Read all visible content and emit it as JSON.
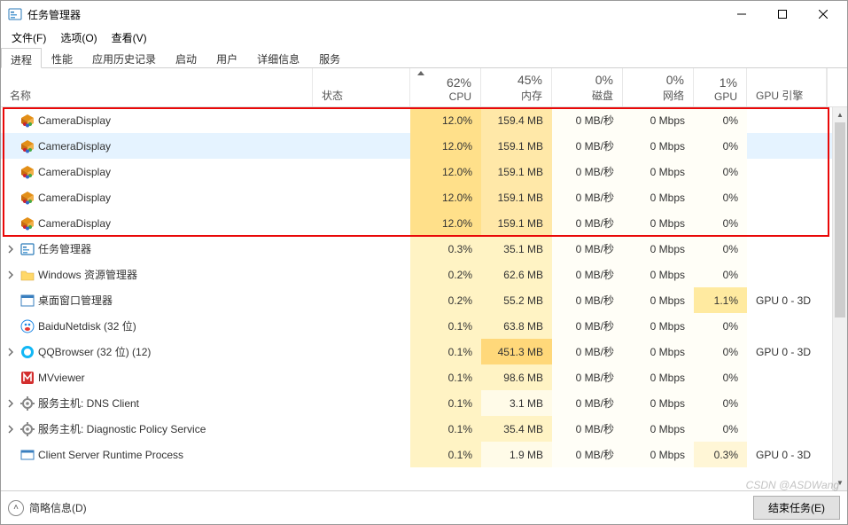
{
  "titlebar": {
    "title": "任务管理器"
  },
  "menubar": {
    "file": "文件(F)",
    "options": "选项(O)",
    "view": "查看(V)"
  },
  "tabs": [
    "进程",
    "性能",
    "应用历史记录",
    "启动",
    "用户",
    "详细信息",
    "服务"
  ],
  "active_tab": 0,
  "columns": {
    "name": "名称",
    "status": "状态",
    "cpu": {
      "pct": "62%",
      "label": "CPU"
    },
    "mem": {
      "pct": "45%",
      "label": "内存"
    },
    "disk": {
      "pct": "0%",
      "label": "磁盘"
    },
    "net": {
      "pct": "0%",
      "label": "网络"
    },
    "gpu": {
      "pct": "1%",
      "label": "GPU"
    },
    "gpuengine": "GPU 引擎"
  },
  "rows": [
    {
      "expand": false,
      "icon": "cube",
      "name": "CameraDisplay",
      "cpu": "12.0%",
      "mem": "159.4 MB",
      "disk": "0 MB/秒",
      "net": "0 Mbps",
      "gpu": "0%",
      "gpuengine": "",
      "cpu_cls": "heat-cpu-12",
      "mem_cls": "heat-mem-159",
      "selected": false
    },
    {
      "expand": false,
      "icon": "cube",
      "name": "CameraDisplay",
      "cpu": "12.0%",
      "mem": "159.1 MB",
      "disk": "0 MB/秒",
      "net": "0 Mbps",
      "gpu": "0%",
      "gpuengine": "",
      "cpu_cls": "heat-cpu-12",
      "mem_cls": "heat-mem-159",
      "selected": true
    },
    {
      "expand": false,
      "icon": "cube",
      "name": "CameraDisplay",
      "cpu": "12.0%",
      "mem": "159.1 MB",
      "disk": "0 MB/秒",
      "net": "0 Mbps",
      "gpu": "0%",
      "gpuengine": "",
      "cpu_cls": "heat-cpu-12",
      "mem_cls": "heat-mem-159",
      "selected": false
    },
    {
      "expand": false,
      "icon": "cube",
      "name": "CameraDisplay",
      "cpu": "12.0%",
      "mem": "159.1 MB",
      "disk": "0 MB/秒",
      "net": "0 Mbps",
      "gpu": "0%",
      "gpuengine": "",
      "cpu_cls": "heat-cpu-12",
      "mem_cls": "heat-mem-159",
      "selected": false
    },
    {
      "expand": false,
      "icon": "cube",
      "name": "CameraDisplay",
      "cpu": "12.0%",
      "mem": "159.1 MB",
      "disk": "0 MB/秒",
      "net": "0 Mbps",
      "gpu": "0%",
      "gpuengine": "",
      "cpu_cls": "heat-cpu-12",
      "mem_cls": "heat-mem-159",
      "selected": false
    },
    {
      "expand": true,
      "icon": "tm",
      "name": "任务管理器",
      "cpu": "0.3%",
      "mem": "35.1 MB",
      "disk": "0 MB/秒",
      "net": "0 Mbps",
      "gpu": "0%",
      "gpuengine": "",
      "cpu_cls": "heat-cpu-low",
      "mem_cls": "heat-mem-mid",
      "selected": false
    },
    {
      "expand": true,
      "icon": "folder",
      "name": "Windows 资源管理器",
      "cpu": "0.2%",
      "mem": "62.6 MB",
      "disk": "0 MB/秒",
      "net": "0 Mbps",
      "gpu": "0%",
      "gpuengine": "",
      "cpu_cls": "heat-cpu-low",
      "mem_cls": "heat-mem-mid",
      "selected": false
    },
    {
      "expand": false,
      "icon": "dwm",
      "name": "桌面窗口管理器",
      "cpu": "0.2%",
      "mem": "55.2 MB",
      "disk": "0 MB/秒",
      "net": "0 Mbps",
      "gpu": "1.1%",
      "gpuengine": "GPU 0 - 3D",
      "cpu_cls": "heat-cpu-low",
      "mem_cls": "heat-mem-mid",
      "gpu_cls": "heat-gpu-11",
      "selected": false
    },
    {
      "expand": false,
      "icon": "baidu",
      "name": "BaiduNetdisk (32 位)",
      "cpu": "0.1%",
      "mem": "63.8 MB",
      "disk": "0 MB/秒",
      "net": "0 Mbps",
      "gpu": "0%",
      "gpuengine": "",
      "cpu_cls": "heat-cpu-low",
      "mem_cls": "heat-mem-mid",
      "selected": false
    },
    {
      "expand": true,
      "icon": "qq",
      "name": "QQBrowser (32 位) (12)",
      "cpu": "0.1%",
      "mem": "451.3 MB",
      "disk": "0 MB/秒",
      "net": "0 Mbps",
      "gpu": "0%",
      "gpuengine": "GPU 0 - 3D",
      "cpu_cls": "heat-cpu-low",
      "mem_cls": "heat-mem-451",
      "selected": false
    },
    {
      "expand": false,
      "icon": "mv",
      "name": "MVviewer",
      "cpu": "0.1%",
      "mem": "98.6 MB",
      "disk": "0 MB/秒",
      "net": "0 Mbps",
      "gpu": "0%",
      "gpuengine": "",
      "cpu_cls": "heat-cpu-low",
      "mem_cls": "heat-mem-mid",
      "selected": false
    },
    {
      "expand": true,
      "icon": "svc",
      "name": "服务主机: DNS Client",
      "cpu": "0.1%",
      "mem": "3.1 MB",
      "disk": "0 MB/秒",
      "net": "0 Mbps",
      "gpu": "0%",
      "gpuengine": "",
      "cpu_cls": "heat-cpu-low",
      "mem_cls": "",
      "selected": false
    },
    {
      "expand": true,
      "icon": "svc",
      "name": "服务主机: Diagnostic Policy Service",
      "cpu": "0.1%",
      "mem": "35.4 MB",
      "disk": "0 MB/秒",
      "net": "0 Mbps",
      "gpu": "0%",
      "gpuengine": "",
      "cpu_cls": "heat-cpu-low",
      "mem_cls": "heat-mem-mid",
      "selected": false
    },
    {
      "expand": false,
      "icon": "csrss",
      "name": "Client Server Runtime Process",
      "cpu": "0.1%",
      "mem": "1.9 MB",
      "disk": "0 MB/秒",
      "net": "0 Mbps",
      "gpu": "0.3%",
      "gpuengine": "GPU 0 - 3D",
      "cpu_cls": "heat-cpu-low",
      "mem_cls": "",
      "gpu_cls": "heat-gpu-03",
      "selected": false
    }
  ],
  "bottombar": {
    "fewer_details": "简略信息(D)",
    "end_task": "结束任务(E)"
  },
  "watermark": "CSDN @ASDWang"
}
